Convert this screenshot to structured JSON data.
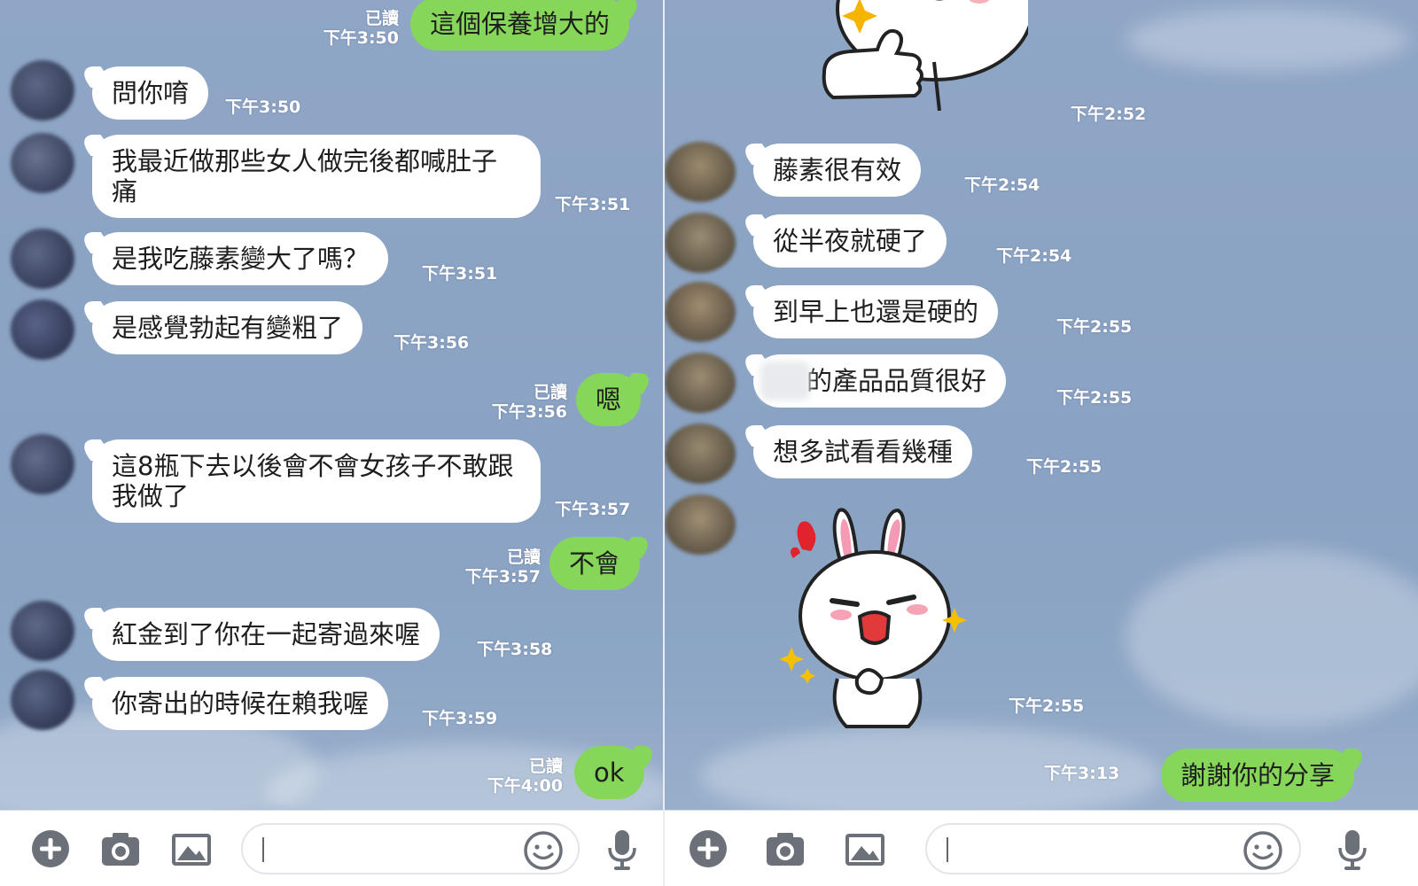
{
  "colors": {
    "background": "#8fa6c6",
    "bubble_in": "#ffffff",
    "bubble_out": "#86d65a",
    "meta_text": "#ffffff"
  },
  "left": {
    "messages": [
      {
        "dir": "out",
        "text": "這個保養增大的",
        "read": "已讀",
        "time": "下午3:50"
      },
      {
        "dir": "in",
        "text": "問你唷",
        "time": "下午3:50"
      },
      {
        "dir": "in",
        "text": "我最近做那些女人做完後都喊肚子痛",
        "time": "下午3:51"
      },
      {
        "dir": "in",
        "text": "是我吃藤素變大了嗎？",
        "time": "下午3:51"
      },
      {
        "dir": "in",
        "text": "是感覺勃起有變粗了",
        "time": "下午3:56"
      },
      {
        "dir": "out",
        "text": "嗯",
        "read": "已讀",
        "time": "下午3:56"
      },
      {
        "dir": "in",
        "text": "這8瓶下去以後會不會女孩子不敢跟我做了",
        "time": "下午3:57"
      },
      {
        "dir": "out",
        "text": "不會",
        "read": "已讀",
        "time": "下午3:57"
      },
      {
        "dir": "in",
        "text": "紅金到了你在一起寄過來喔",
        "time": "下午3:58"
      },
      {
        "dir": "in",
        "text": "你寄出的時候在賴我喔",
        "time": "下午3:59"
      },
      {
        "dir": "out",
        "text": "ok",
        "read": "已讀",
        "time": "下午4:00"
      }
    ]
  },
  "right": {
    "sticker_top_time": "下午2:52",
    "messages": [
      {
        "dir": "in",
        "text": "藤素很有效",
        "time": "下午2:54"
      },
      {
        "dir": "in",
        "text": "從半夜就硬了",
        "time": "下午2:54"
      },
      {
        "dir": "in",
        "text": "到早上也還是硬的",
        "time": "下午2:55"
      },
      {
        "dir": "in",
        "text": "的產品品質很好",
        "time": "下午2:55"
      },
      {
        "dir": "in",
        "text": "想多試看看幾種",
        "time": "下午2:55"
      }
    ],
    "sticker_bottom_time": "下午2:55",
    "last_out": {
      "text": "謝謝你的分享",
      "time": "下午3:13"
    }
  },
  "icons": [
    "plus-icon",
    "camera-icon",
    "image-icon",
    "emoji-icon",
    "microphone-icon"
  ]
}
